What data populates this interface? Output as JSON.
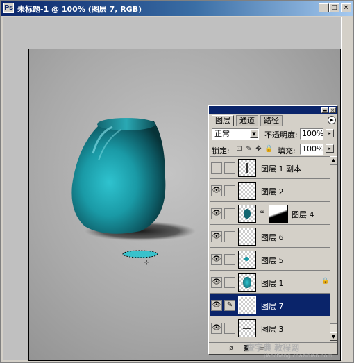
{
  "window": {
    "title": "未标题-1 @ 100% (图层 7, RGB)",
    "icon": "photoshop-doc-icon",
    "buttons": [
      "minimize-icon",
      "maximize-icon",
      "close-icon"
    ]
  },
  "canvas": {
    "marquee_selection": "elliptical-selection"
  },
  "layers_palette": {
    "tabs": [
      "图层",
      "通道",
      "路径"
    ],
    "active_tab": "图层",
    "blend_mode": "正常",
    "opacity_label": "不透明度:",
    "opacity_value": "100%",
    "lock_label": "锁定:",
    "fill_label": "填充:",
    "fill_value": "100%",
    "layers": [
      {
        "name": "图层 1 副本",
        "visible": false,
        "thumb": "vertical-stroke"
      },
      {
        "name": "图层 2",
        "visible": true,
        "thumb": "empty"
      },
      {
        "name": "图层 4",
        "visible": true,
        "thumb": "teal-dot",
        "has_mask": true
      },
      {
        "name": "图层 6",
        "visible": true,
        "thumb": "small-dash"
      },
      {
        "name": "图层 5",
        "visible": true,
        "thumb": "teal-dot-small"
      },
      {
        "name": "图层 1",
        "visible": true,
        "thumb": "teal-vase",
        "locked": true
      },
      {
        "name": "图层 7",
        "visible": true,
        "thumb": "empty",
        "selected": true
      },
      {
        "name": "图层 3",
        "visible": true,
        "thumb": "dash"
      }
    ]
  },
  "watermark": {
    "main": "查字典 教程网",
    "sub": "jiaocheng.chazidian.com"
  }
}
